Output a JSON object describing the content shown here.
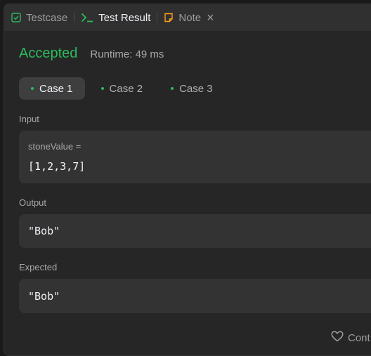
{
  "tabs": [
    {
      "label": "Testcase",
      "icon": "checkbox-icon",
      "active": false
    },
    {
      "label": "Test Result",
      "icon": "terminal-icon",
      "active": true
    },
    {
      "label": "Note",
      "icon": "note-icon",
      "active": false
    }
  ],
  "close_glyph": "×",
  "result": {
    "status": "Accepted",
    "runtime": "Runtime: 49 ms"
  },
  "cases": [
    {
      "label": "Case 1",
      "active": true
    },
    {
      "label": "Case 2",
      "active": false
    },
    {
      "label": "Case 3",
      "active": false
    }
  ],
  "input": {
    "label": "Input",
    "var_name": "stoneValue =",
    "value": "[1,2,3,7]"
  },
  "output": {
    "label": "Output",
    "value": "\"Bob\""
  },
  "expected": {
    "label": "Expected",
    "value": "\"Bob\""
  },
  "footer": {
    "label": "Cont",
    "icon": "heart-icon"
  },
  "colors": {
    "accent_green": "#2cbb5d",
    "note_icon": "#ffa116",
    "background": "#262626"
  }
}
